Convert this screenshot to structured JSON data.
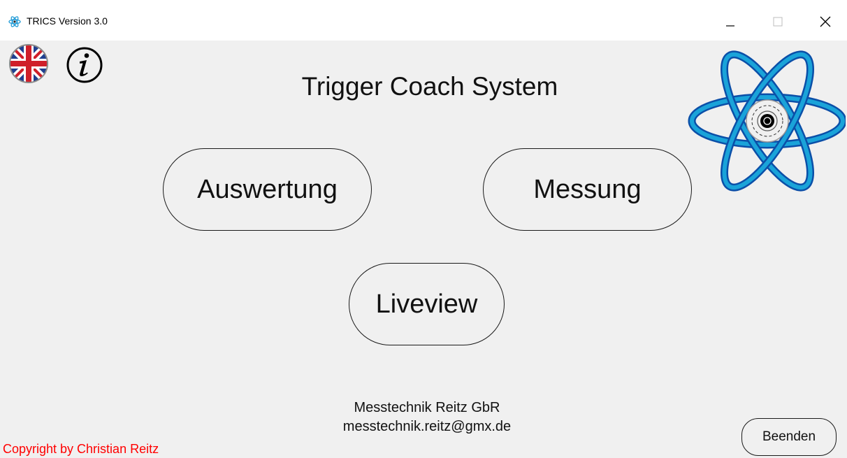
{
  "window": {
    "title": "TRICS Version 3.0",
    "controls": {
      "minimize": "minimize-icon",
      "maximize": "maximize-icon",
      "close": "close-icon"
    }
  },
  "toolbar": {
    "language_icon": "uk-flag-icon",
    "info_icon": "info-icon"
  },
  "main": {
    "heading": "Trigger Coach System",
    "buttons": {
      "auswertung": "Auswertung",
      "messung": "Messung",
      "liveview": "Liveview"
    }
  },
  "footer": {
    "company": "Messtechnik Reitz GbR",
    "email": "messtechnik.reitz@gmx.de",
    "copyright": "Copyright by Christian Reitz",
    "exit_button": "Beenden"
  },
  "colors": {
    "background": "#f0f0f0",
    "titlebar": "#ffffff",
    "copyright": "#ff0000",
    "logo_blue": "#1aa3d9",
    "logo_dark_blue": "#0b4fa8"
  }
}
